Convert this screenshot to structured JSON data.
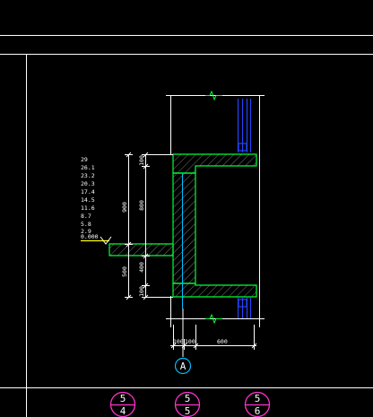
{
  "elevation_marks": [
    "29",
    "26.1",
    "23.2",
    "20.3",
    "17.4",
    "14.5",
    "11.6",
    "8.7",
    "5.8",
    "2.9",
    "0.000"
  ],
  "dimensions": {
    "left_outer": [
      "900",
      "500"
    ],
    "left_inner": [
      "100",
      "800",
      "400",
      "100"
    ],
    "bottom": [
      "100",
      "100",
      "600"
    ]
  },
  "axis_label": "A",
  "section_symbols": [
    {
      "top": "5",
      "bottom": "4"
    },
    {
      "top": "5",
      "bottom": "5"
    },
    {
      "top": "5",
      "bottom": "6"
    }
  ],
  "colors": {
    "background": "#000000",
    "frame": "#ffffff",
    "dimension": "#ffffff",
    "wall_outline": "#00ff33",
    "hatch": "#808080",
    "elevation_bar": "#ffff00",
    "axis_line": "#00bfff",
    "window": "#2244ff",
    "section_circle": "#ff33cc"
  }
}
